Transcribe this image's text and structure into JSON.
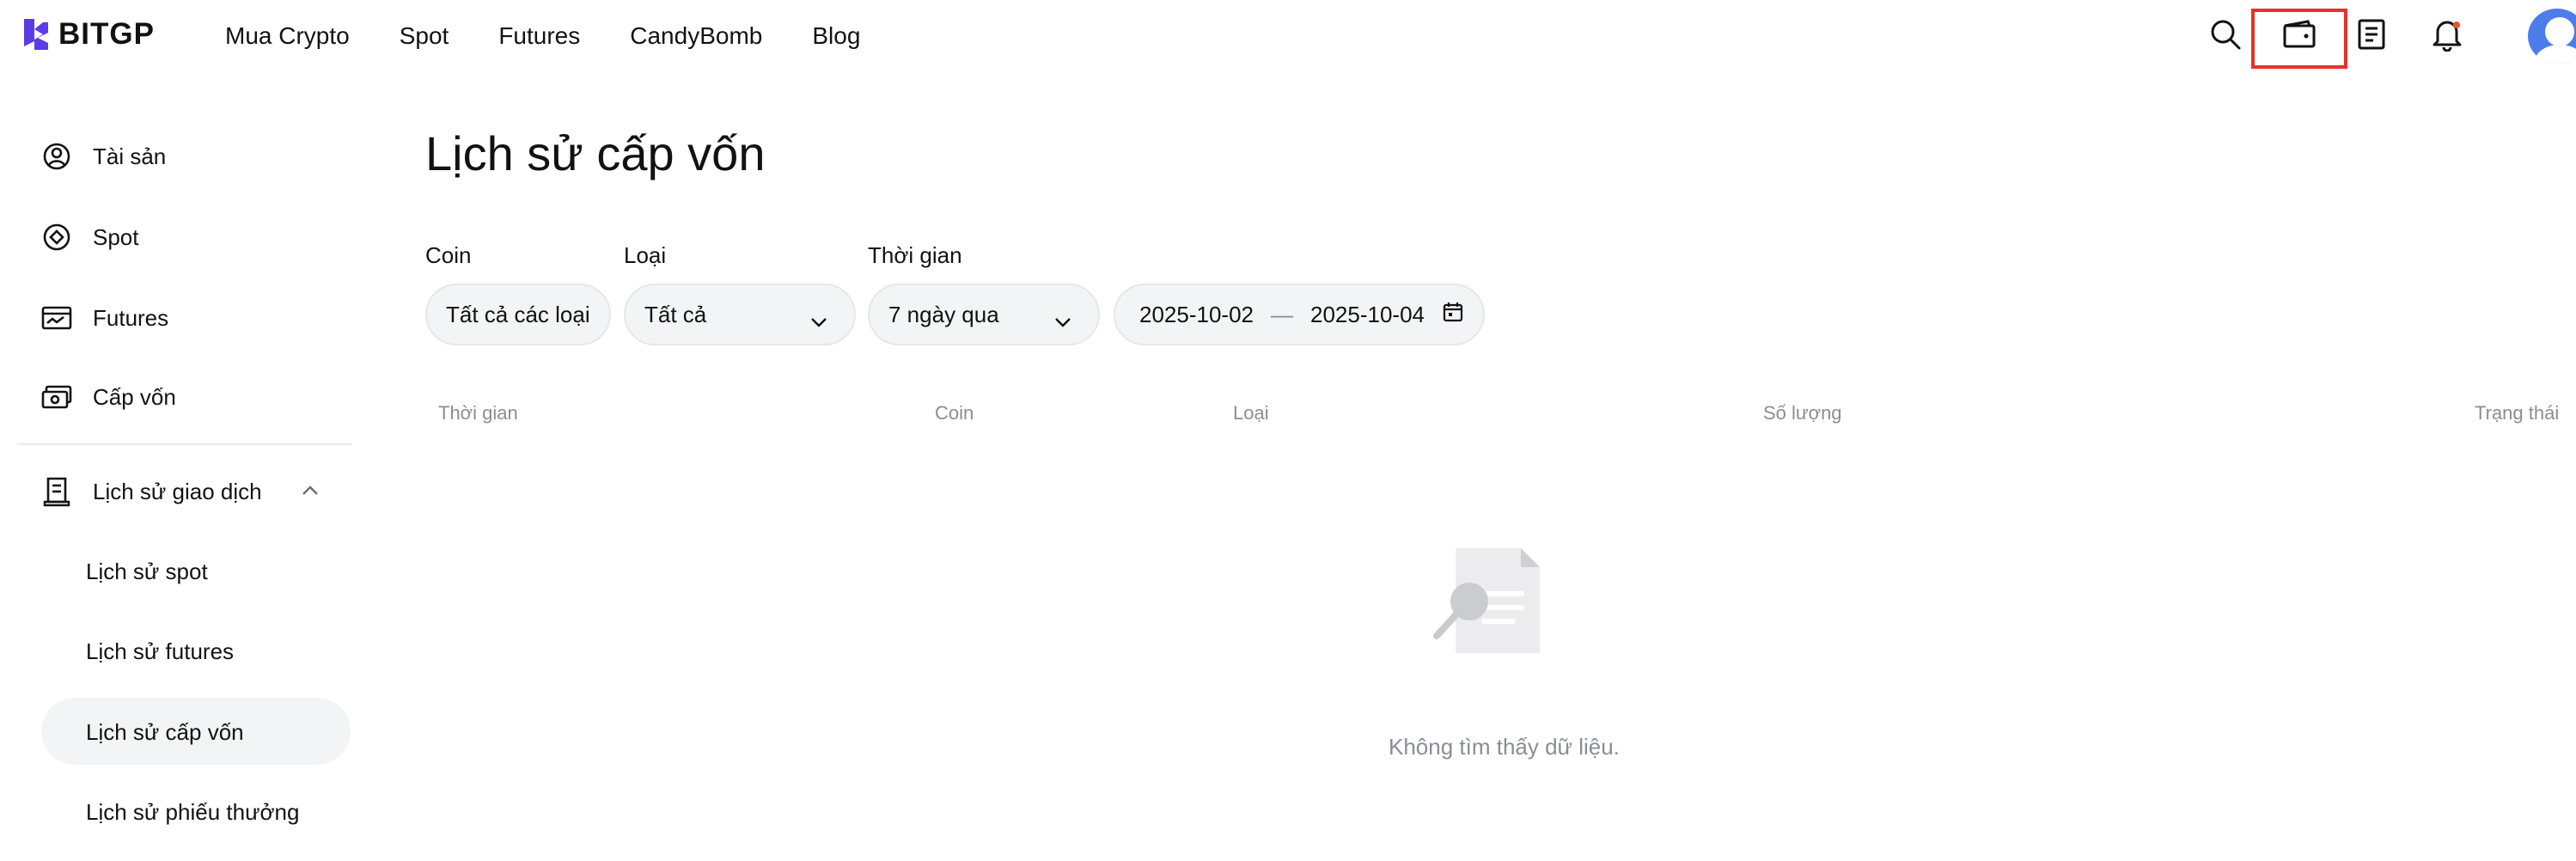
{
  "brand": {
    "name": "BITGP",
    "accent": "#5b3be8"
  },
  "nav": {
    "items": [
      "Mua Crypto",
      "Spot",
      "Futures",
      "CandyBomb",
      "Blog"
    ]
  },
  "header_icons": [
    "search-icon",
    "wallet-icon",
    "orders-icon",
    "bell-icon",
    "avatar"
  ],
  "highlight": {
    "target": "wallet-icon",
    "color": "#e53323"
  },
  "sidebar": {
    "items": [
      {
        "label": "Tài sản",
        "icon": "user-circle-icon"
      },
      {
        "label": "Spot",
        "icon": "diamond-icon"
      },
      {
        "label": "Futures",
        "icon": "chart-card-icon"
      },
      {
        "label": "Cấp vốn",
        "icon": "money-icon"
      },
      {
        "label": "Lịch sử giao dịch",
        "icon": "receipt-icon",
        "expanded": true
      }
    ],
    "sub_items": [
      "Lịch sử spot",
      "Lịch sử futures",
      "Lịch sử cấp vốn",
      "Lịch sử phiếu thưởng"
    ],
    "active_sub": "Lịch sử cấp vốn"
  },
  "main": {
    "title": "Lịch sử cấp vốn",
    "filters": {
      "coin": {
        "label": "Coin",
        "value": "Tất cả các loại"
      },
      "type": {
        "label": "Loại",
        "value": "Tất cả"
      },
      "time": {
        "label": "Thời gian",
        "value": "7 ngày qua"
      },
      "date_from": "2025-10-02",
      "date_sep": "—",
      "date_to": "2025-10-04"
    },
    "table": {
      "headers": [
        "Thời gian",
        "Coin",
        "Loại",
        "Số lượng",
        "Trạng thái"
      ],
      "rows": []
    },
    "empty_text": "Không tìm thấy dữ liệu."
  }
}
